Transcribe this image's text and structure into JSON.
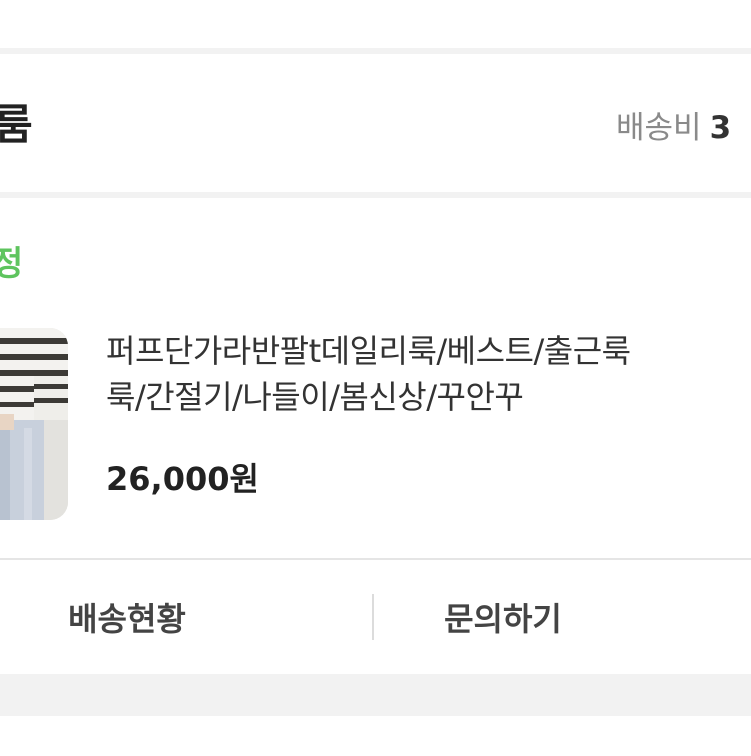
{
  "store": {
    "name_fragment": "룸",
    "shipping_label": "배송비",
    "shipping_value": "3"
  },
  "order": {
    "status_fragment": "정",
    "status_color": "#5ec45e",
    "product": {
      "title_line1": "퍼프단가라반팔t데일리룩/베스트/출근룩",
      "title_line2": "룩/간절기/나들이/봄신상/꾸안꾸",
      "price": "26,000원"
    }
  },
  "actions": {
    "shipping_status_label": "배송현황",
    "inquiry_label": "문의하기"
  }
}
